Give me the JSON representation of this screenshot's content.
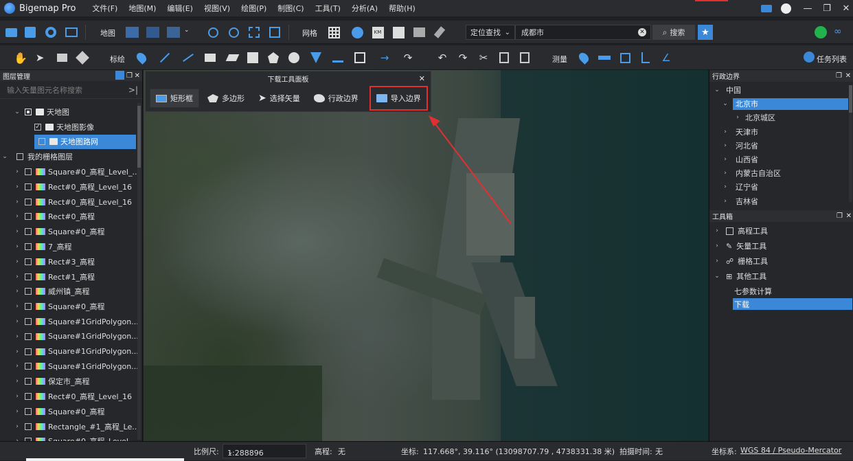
{
  "app": {
    "title": "Bigemap Pro"
  },
  "menu": [
    "文件(F)",
    "地图(M)",
    "编辑(E)",
    "视图(V)",
    "绘图(P)",
    "制图(C)",
    "工具(T)",
    "分析(A)",
    "帮助(H)"
  ],
  "toolbar1": {
    "map_label": "地图",
    "grid_label": "网格",
    "locate_select": "定位查找",
    "search_value": "成都市",
    "search_button": "搜索"
  },
  "toolbar2": {
    "mark_label": "标绘",
    "measure_label": "测量",
    "tasks_label": "任务列表"
  },
  "layers": {
    "title": "图层管理",
    "search_placeholder": "输入矢量图元名称搜索",
    "tianditu": "天地图",
    "tianditu_image": "天地图影像",
    "tianditu_road": "天地图路网",
    "my_grid": "我的栅格图层",
    "items": [
      "Square#0_高程_Level_...",
      "Rect#0_高程_Level_16",
      "Rect#0_高程_Level_16",
      "Rect#0_高程",
      "Square#0_高程",
      "7_高程",
      "Rect#3_高程",
      "Rect#1_高程",
      "威州镇_高程",
      "Square#0_高程",
      "Square#1GridPolygon...",
      "Square#1GridPolygon...",
      "Square#1GridPolygon...",
      "Square#1GridPolygon...",
      "保定市_高程",
      "Rect#0_高程_Level_16",
      "Square#0_高程",
      "Rectangle_#1_高程_Le...",
      "Square#0_高程_Level_..."
    ]
  },
  "download_panel": {
    "title": "下载工具面板",
    "tools": [
      "矩形框",
      "多边形",
      "选择矢量",
      "行政边界",
      "导入边界"
    ]
  },
  "admin": {
    "title": "行政边界",
    "china": "中国",
    "beijing": "北京市",
    "beijing_city": "北京城区",
    "provinces": [
      "天津市",
      "河北省",
      "山西省",
      "内蒙古自治区",
      "辽宁省",
      "吉林省"
    ]
  },
  "toolbox": {
    "title": "工具箱",
    "items": [
      "高程工具",
      "矢量工具",
      "栅格工具",
      "其他工具"
    ],
    "sub": [
      "七参数计算",
      "下载"
    ]
  },
  "status": {
    "scale_label": "比例尺:",
    "scale_value": "1:288896",
    "elev_label": "高程:",
    "elev_value": "无",
    "coord_label": "坐标:",
    "coord_value": "117.668°, 39.116°  (13098707.79 , 4738331.38 米)",
    "shot_label": "拍摄时间:",
    "shot_value": "无",
    "crs_label": "坐标系:",
    "crs_value": "WGS 84 / Pseudo-Mercator"
  },
  "colors": {
    "accent": "#3b87d8",
    "highlight_red": "#e03030"
  }
}
